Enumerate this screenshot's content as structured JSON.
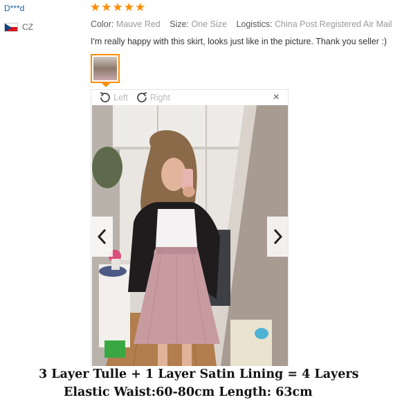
{
  "review": {
    "reviewer": "D***d",
    "country": "CZ",
    "rating": 5,
    "attributes": [
      {
        "label": "Color:",
        "value": "Mauve Red"
      },
      {
        "label": "Size:",
        "value": "One Size"
      },
      {
        "label": "Logistics:",
        "value": "China Post Registered Air Mail"
      }
    ],
    "text": "I'm really happy with this skirt, looks just like in the picture. Thank you seller :)"
  },
  "viewer": {
    "rotate_left": "Left",
    "rotate_right": "Right",
    "close": "×"
  },
  "caption": {
    "line1": "3 Layer Tulle + 1 Layer Satin Lining = 4 Layers",
    "line2": "Elastic Waist:60-80cm  Length: 63cm"
  },
  "colors": {
    "accent": "#ff8c00",
    "link": "#1a5fa8"
  }
}
